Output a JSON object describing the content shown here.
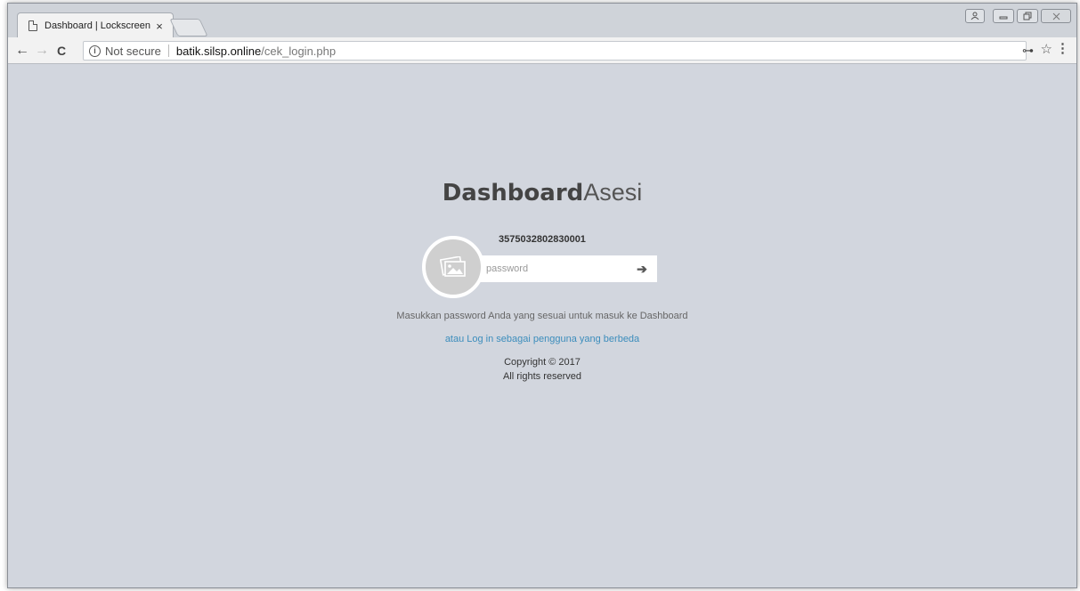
{
  "browser": {
    "tab_title": "Dashboard | Lockscreen",
    "tab_close": "×",
    "address": {
      "security_label": "Not secure",
      "host": "batik.silsp.online",
      "path": "/cek_login.php"
    },
    "icons": {
      "back": "←",
      "forward": "→",
      "reload": "C",
      "info": "i",
      "key": "⊶",
      "star": "☆",
      "menu": "⋮"
    }
  },
  "lockscreen": {
    "logo_bold": "Dashboard",
    "logo_light": "Asesi",
    "username": "3575032802830001",
    "password_placeholder": "password",
    "submit_icon": "➔",
    "help_text": "Masukkan password Anda yang sesuai untuk masuk ke Dashboard",
    "other_login_link": "atau Log in sebagai pengguna yang berbeda",
    "copyright_line1": "Copyright © 2017",
    "copyright_line2": "All rights reserved"
  },
  "colors": {
    "page_background": "#d2d6de",
    "link": "#3c8dbc"
  }
}
